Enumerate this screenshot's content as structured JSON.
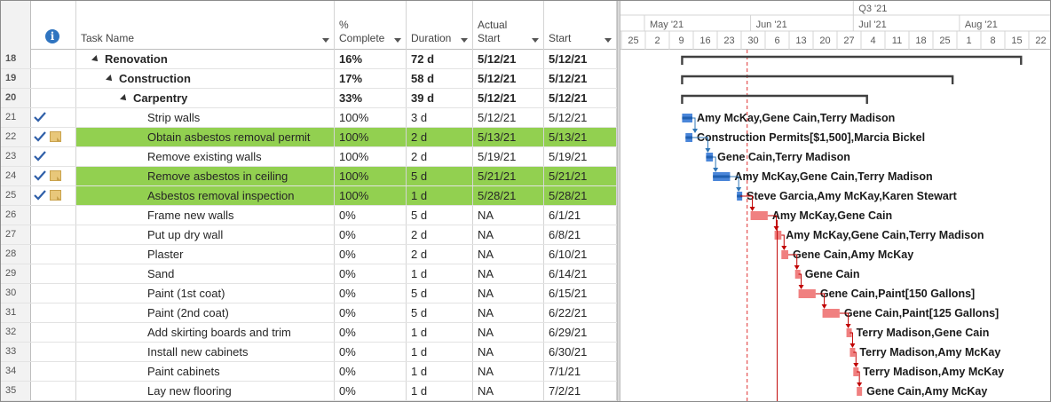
{
  "grid": {
    "columns": {
      "info_icon": "i",
      "task_name": "Task Name",
      "pct_complete": "%\nComplete",
      "duration": "Duration",
      "actual_start": "Actual\nStart",
      "start": "Start"
    },
    "rows": [
      {
        "id": "18",
        "name": "Renovation",
        "level": 0,
        "summary": true,
        "pct": "16%",
        "dur": "72 d",
        "astart": "5/12/21",
        "start": "5/12/21",
        "done": false,
        "note": false,
        "highlight": false
      },
      {
        "id": "19",
        "name": "Construction",
        "level": 1,
        "summary": true,
        "pct": "17%",
        "dur": "58 d",
        "astart": "5/12/21",
        "start": "5/12/21",
        "done": false,
        "note": false,
        "highlight": false
      },
      {
        "id": "20",
        "name": "Carpentry",
        "level": 2,
        "summary": true,
        "pct": "33%",
        "dur": "39 d",
        "astart": "5/12/21",
        "start": "5/12/21",
        "done": false,
        "note": false,
        "highlight": false
      },
      {
        "id": "21",
        "name": "Strip walls",
        "level": 3,
        "summary": false,
        "pct": "100%",
        "dur": "3 d",
        "astart": "5/12/21",
        "start": "5/12/21",
        "done": true,
        "note": false,
        "highlight": false
      },
      {
        "id": "22",
        "name": "Obtain asbestos removal permit",
        "level": 3,
        "summary": false,
        "pct": "100%",
        "dur": "2 d",
        "astart": "5/13/21",
        "start": "5/13/21",
        "done": true,
        "note": true,
        "highlight": true
      },
      {
        "id": "23",
        "name": "Remove existing walls",
        "level": 3,
        "summary": false,
        "pct": "100%",
        "dur": "2 d",
        "astart": "5/19/21",
        "start": "5/19/21",
        "done": true,
        "note": false,
        "highlight": false
      },
      {
        "id": "24",
        "name": "Remove asbestos in ceiling",
        "level": 3,
        "summary": false,
        "pct": "100%",
        "dur": "5 d",
        "astart": "5/21/21",
        "start": "5/21/21",
        "done": true,
        "note": true,
        "highlight": true
      },
      {
        "id": "25",
        "name": "Asbestos removal inspection",
        "level": 3,
        "summary": false,
        "pct": "100%",
        "dur": "1 d",
        "astart": "5/28/21",
        "start": "5/28/21",
        "done": true,
        "note": true,
        "highlight": true
      },
      {
        "id": "26",
        "name": "Frame new walls",
        "level": 3,
        "summary": false,
        "pct": "0%",
        "dur": "5 d",
        "astart": "NA",
        "start": "6/1/21",
        "done": false,
        "note": false,
        "highlight": false
      },
      {
        "id": "27",
        "name": "Put up dry wall",
        "level": 3,
        "summary": false,
        "pct": "0%",
        "dur": "2 d",
        "astart": "NA",
        "start": "6/8/21",
        "done": false,
        "note": false,
        "highlight": false
      },
      {
        "id": "28",
        "name": "Plaster",
        "level": 3,
        "summary": false,
        "pct": "0%",
        "dur": "2 d",
        "astart": "NA",
        "start": "6/10/21",
        "done": false,
        "note": false,
        "highlight": false
      },
      {
        "id": "29",
        "name": "Sand",
        "level": 3,
        "summary": false,
        "pct": "0%",
        "dur": "1 d",
        "astart": "NA",
        "start": "6/14/21",
        "done": false,
        "note": false,
        "highlight": false
      },
      {
        "id": "30",
        "name": "Paint (1st coat)",
        "level": 3,
        "summary": false,
        "pct": "0%",
        "dur": "5 d",
        "astart": "NA",
        "start": "6/15/21",
        "done": false,
        "note": false,
        "highlight": false
      },
      {
        "id": "31",
        "name": "Paint (2nd coat)",
        "level": 3,
        "summary": false,
        "pct": "0%",
        "dur": "5 d",
        "astart": "NA",
        "start": "6/22/21",
        "done": false,
        "note": false,
        "highlight": false
      },
      {
        "id": "32",
        "name": "Add skirting boards and trim",
        "level": 3,
        "summary": false,
        "pct": "0%",
        "dur": "1 d",
        "astart": "NA",
        "start": "6/29/21",
        "done": false,
        "note": false,
        "highlight": false
      },
      {
        "id": "33",
        "name": "Install new cabinets",
        "level": 3,
        "summary": false,
        "pct": "0%",
        "dur": "1 d",
        "astart": "NA",
        "start": "6/30/21",
        "done": false,
        "note": false,
        "highlight": false
      },
      {
        "id": "34",
        "name": "Paint cabinets",
        "level": 3,
        "summary": false,
        "pct": "0%",
        "dur": "1 d",
        "astart": "NA",
        "start": "7/1/21",
        "done": false,
        "note": false,
        "highlight": false
      },
      {
        "id": "35",
        "name": "Lay new flooring",
        "level": 3,
        "summary": false,
        "pct": "0%",
        "dur": "1 d",
        "astart": "NA",
        "start": "7/2/21",
        "done": false,
        "note": false,
        "highlight": false
      }
    ]
  },
  "gantt": {
    "quarter_label": "Q3 '21",
    "months": [
      "May '21",
      "Jun '21",
      "Jul '21",
      "Aug '21"
    ],
    "week_ticks": [
      "25",
      "2",
      "9",
      "16",
      "23",
      "30",
      "6",
      "13",
      "20",
      "27",
      "4",
      "11",
      "18",
      "25",
      "1",
      "8",
      "15",
      "22"
    ],
    "status_date": "5/31/21",
    "resource_labels": [
      "",
      "",
      "",
      "Amy McKay,Gene Cain,Terry Madison",
      "Construction Permits[$1,500],Marcia Bickel",
      "Gene Cain,Terry Madison",
      "Amy McKay,Gene Cain,Terry Madison",
      "Steve Garcia,Amy McKay,Karen Stewart",
      "Amy McKay,Gene Cain",
      "Amy McKay,Gene Cain,Terry Madison",
      "Gene Cain,Amy McKay",
      "Gene Cain",
      "Gene Cain,Paint[150 Gallons]",
      "Gene Cain,Paint[125 Gallons]",
      "Terry Madison,Gene Cain",
      "Terry Madison,Amy McKay",
      "Terry Madison,Amy McKay",
      "Gene Cain,Amy McKay"
    ],
    "colors": {
      "complete_bar": "#4a86d9",
      "critical_bar": "#f08080",
      "critical_link": "#c00000",
      "normal_link": "#2e75b6",
      "summary_bar": "#404040",
      "status_line": "#e03030"
    }
  }
}
